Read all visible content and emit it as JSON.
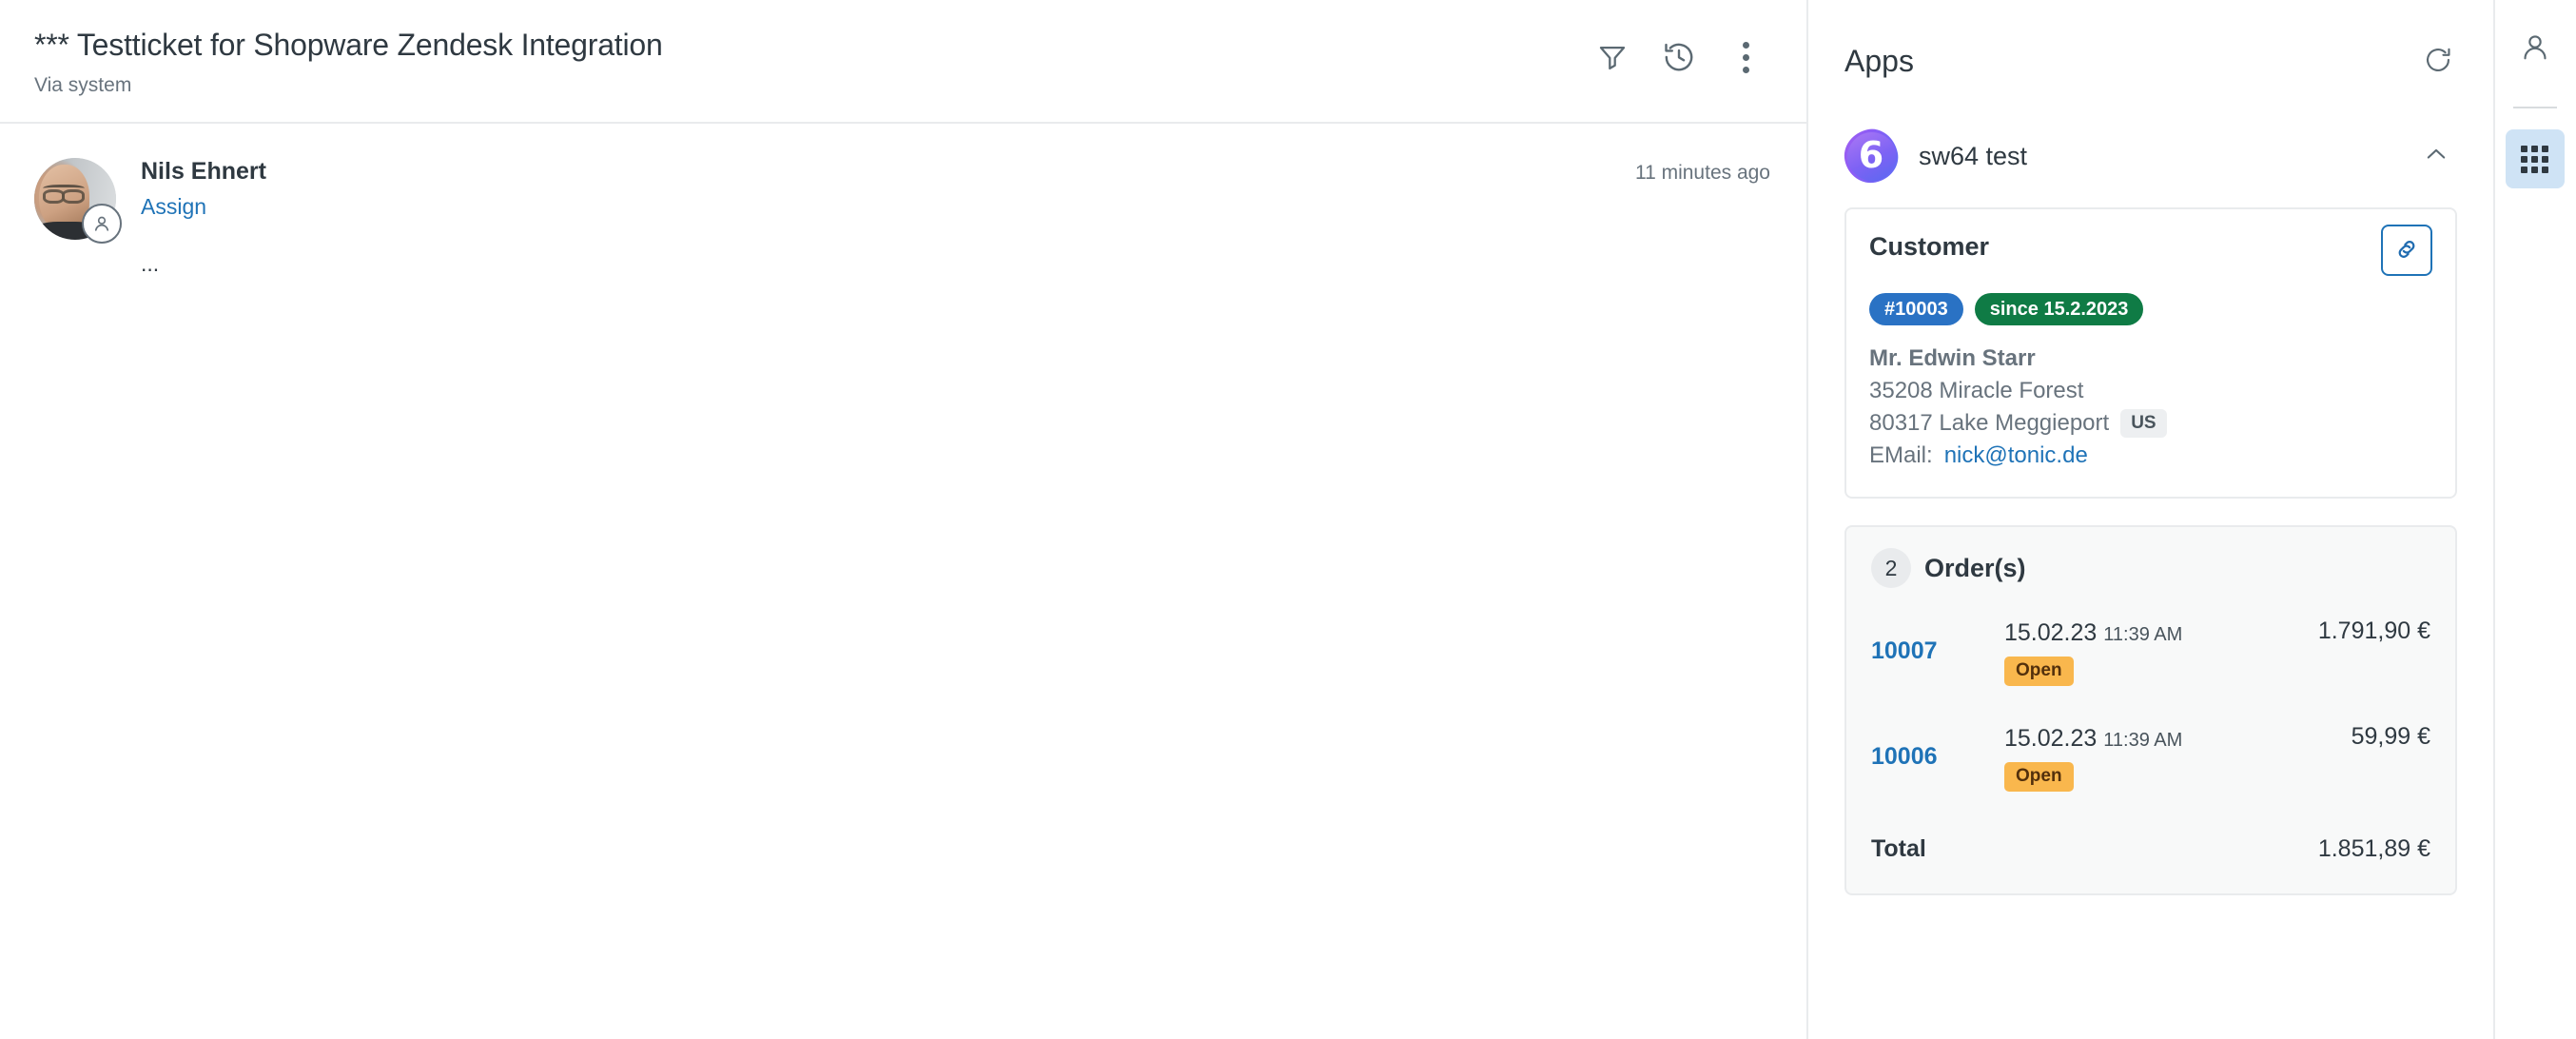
{
  "ticket": {
    "title": "*** Testticket for Shopware Zendesk Integration",
    "subtitle": "Via system",
    "header_actions": [
      {
        "name": "filter-icon",
        "label": "Filter"
      },
      {
        "name": "history-icon",
        "label": "Conversation history"
      },
      {
        "name": "more-options-icon",
        "label": "More options"
      }
    ],
    "comment": {
      "author": "Nils Ehnert",
      "assign_label": "Assign",
      "timestamp": "11 minutes ago",
      "body": "..."
    }
  },
  "apps": {
    "title": "Apps",
    "refresh_label": "Refresh",
    "app": {
      "name": "sw64 test",
      "logo_text": "6",
      "collapse_label": "Collapse"
    },
    "customer": {
      "title": "Customer",
      "link_button_label": "Open customer",
      "badges": [
        {
          "text": "#10003",
          "color": "#2a72c4"
        },
        {
          "text": "since 15.2.2023",
          "color": "#0f7b45"
        }
      ],
      "name": "Mr. Edwin Starr",
      "address_line": "35208 Miracle Forest",
      "city_line": "80317 Lake Meggieport",
      "country": "US",
      "email_label": "EMail:",
      "email": "nick@tonic.de"
    },
    "orders": {
      "count": "2",
      "title": "Order(s)",
      "items": [
        {
          "id": "10007",
          "date": "15.02.23",
          "time": "11:39 AM",
          "status": "Open",
          "status_color": "#f9b74d",
          "amount": "1.791,90 €"
        },
        {
          "id": "10006",
          "date": "15.02.23",
          "time": "11:39 AM",
          "status": "Open",
          "status_color": "#f9b74d",
          "amount": "59,99 €"
        }
      ],
      "total_label": "Total",
      "total_amount": "1.851,89 €"
    }
  },
  "rail": {
    "user_label": "User profile",
    "apps_label": "Apps"
  }
}
